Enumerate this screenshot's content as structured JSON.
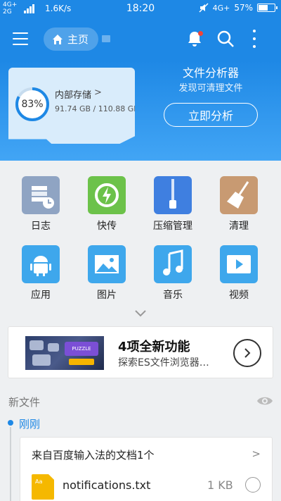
{
  "status_bar": {
    "network_top": "4G+",
    "network_bottom": "2G",
    "speed": "1.6K/s",
    "time": "18:20",
    "network_right": "4G+",
    "battery": "57%",
    "battery_level": 0.57
  },
  "app_bar": {
    "home_label": "主页",
    "icons": [
      "menu-icon",
      "home-icon",
      "bell-icon",
      "search-icon",
      "more-icon"
    ],
    "notification_dot_color": "#f44336"
  },
  "storage": {
    "title": "内部存储",
    "arrow": ">",
    "percent": "83%",
    "percent_value": 83,
    "used_total": "91.74 GB / 110.88 GB"
  },
  "analyzer": {
    "title": "文件分析器",
    "subtitle": "发现可清理文件",
    "button": "立即分析"
  },
  "grid": {
    "items": [
      {
        "label": "日志",
        "icon": "log-icon",
        "color": "#8fa4c3"
      },
      {
        "label": "快传",
        "icon": "transfer-icon",
        "color": "#6cc24a"
      },
      {
        "label": "压缩管理",
        "icon": "zip-icon",
        "color": "#3f7fe0"
      },
      {
        "label": "清理",
        "icon": "broom-icon",
        "color": "#c89a72"
      },
      {
        "label": "应用",
        "icon": "android-icon",
        "color": "#3ea7ec"
      },
      {
        "label": "图片",
        "icon": "image-icon",
        "color": "#3ea7ec"
      },
      {
        "label": "音乐",
        "icon": "music-icon",
        "color": "#3ea7ec"
      },
      {
        "label": "视频",
        "icon": "video-icon",
        "color": "#3ea7ec"
      }
    ]
  },
  "promo": {
    "title": "4项全新功能",
    "subtitle": "探索ES文件浏览器…",
    "image_badge": "Solve the Puzzle"
  },
  "new_files": {
    "label": "新文件",
    "time_group": "刚刚",
    "card_title": "来自百度输入法的文档1个",
    "card_arrow": ">",
    "file_icon_text": "Aa",
    "file_name": "notifications.txt",
    "file_size": "1 KB"
  },
  "colors": {
    "accent": "#1e88e5",
    "header_gradient_end": "#42a5f5"
  }
}
